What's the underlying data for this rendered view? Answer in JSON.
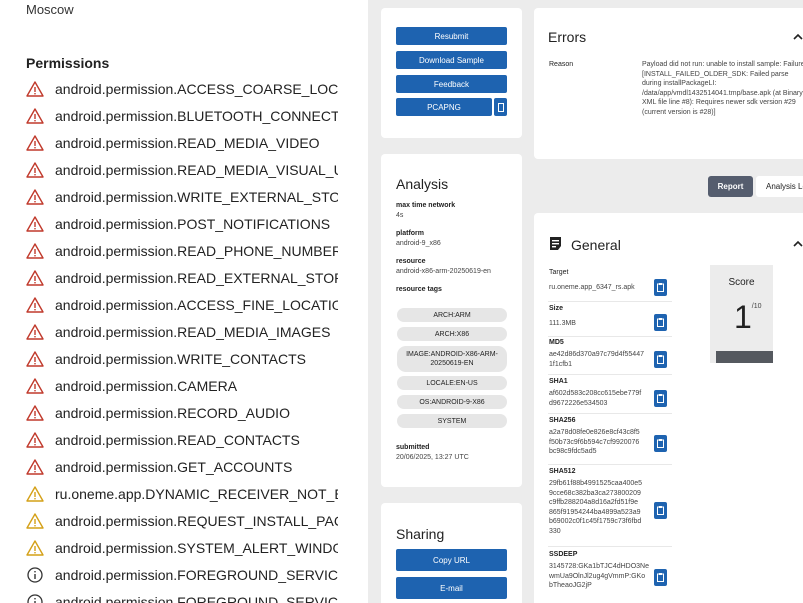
{
  "left": {
    "city": "Moscow",
    "permissions_title": "Permissions",
    "permissions": [
      {
        "name": "android.permission.ACCESS_COARSE_LOCATIC",
        "level": "danger"
      },
      {
        "name": "android.permission.BLUETOOTH_CONNECT",
        "level": "danger"
      },
      {
        "name": "android.permission.READ_MEDIA_VIDEO",
        "level": "danger"
      },
      {
        "name": "android.permission.READ_MEDIA_VISUAL_USE",
        "level": "danger"
      },
      {
        "name": "android.permission.WRITE_EXTERNAL_STORAG",
        "level": "danger"
      },
      {
        "name": "android.permission.POST_NOTIFICATIONS",
        "level": "danger"
      },
      {
        "name": "android.permission.READ_PHONE_NUMBERS",
        "level": "danger"
      },
      {
        "name": "android.permission.READ_EXTERNAL_STORAG",
        "level": "danger"
      },
      {
        "name": "android.permission.ACCESS_FINE_LOCATION",
        "level": "danger"
      },
      {
        "name": "android.permission.READ_MEDIA_IMAGES",
        "level": "danger"
      },
      {
        "name": "android.permission.WRITE_CONTACTS",
        "level": "danger"
      },
      {
        "name": "android.permission.CAMERA",
        "level": "danger"
      },
      {
        "name": "android.permission.RECORD_AUDIO",
        "level": "danger"
      },
      {
        "name": "android.permission.READ_CONTACTS",
        "level": "danger"
      },
      {
        "name": "android.permission.GET_ACCOUNTS",
        "level": "danger"
      },
      {
        "name": "ru.oneme.app.DYNAMIC_RECEIVER_NOT_EXPC",
        "level": "warning"
      },
      {
        "name": "android.permission.REQUEST_INSTALL_PACKA",
        "level": "warning"
      },
      {
        "name": "android.permission.SYSTEM_ALERT_WINDOW",
        "level": "warning"
      },
      {
        "name": "android.permission.FOREGROUND_SERVICE_M",
        "level": "info"
      },
      {
        "name": "android.permission.FOREGROUND_SERVICE_C",
        "level": "info"
      }
    ]
  },
  "actions": {
    "resubmit": "Resubmit",
    "download_sample": "Download Sample",
    "feedback": "Feedback",
    "pcapng": "PCAPNG"
  },
  "analysis": {
    "title": "Analysis",
    "max_time_network_label": "max time network",
    "max_time_network_value": "4s",
    "platform_label": "platform",
    "platform_value": "android-9_x86",
    "resource_label": "resource",
    "resource_value": "android-x86-arm-20250619-en",
    "resource_tags_label": "resource tags",
    "tags": [
      "ARCH:ARM",
      "ARCH:X86",
      "IMAGE:ANDROID-X86-ARM-20250619-EN",
      "LOCALE:EN-US",
      "OS:ANDROID-9-X86",
      "SYSTEM"
    ],
    "submitted_label": "submitted",
    "submitted_value": "20/06/2025, 13:27 UTC"
  },
  "sharing": {
    "title": "Sharing",
    "copy_url": "Copy URL",
    "email": "E-mail"
  },
  "errors": {
    "title": "Errors",
    "reason_label": "Reason",
    "reason_text": "Payload did not run: unable to install sample: Failure [INSTALL_FAILED_OLDER_SDK: Failed parse during installPackageLI: /data/app/vmdl1432514041.tmp/base.apk (at Binary XML file line #8): Requires newer sdk version #29 (current version is #28)]"
  },
  "tabs": {
    "report": "Report",
    "analysis_log": "Analysis Log"
  },
  "general": {
    "title": "General",
    "target_label": "Target",
    "target_value": "ru.oneme.app_6347_rs.apk",
    "size_label": "Size",
    "size_value": "111.3MB",
    "md5_label": "MD5",
    "md5_value": "ae42d86d370a97c79d4f55447 1f1cfb1",
    "sha1_label": "SHA1",
    "sha1_value": "af602d583c208cc615ebe779f d9672226e534503",
    "sha256_label": "SHA256",
    "sha256_value": "a2a78d08fe0e826e8cf43c8f5 f50b73c9f6b594c7cf9920076 bc98c9fdc5ad5",
    "sha512_label": "SHA512",
    "sha512_value": "29fb61f88b4991525caa400e5 9cce68c382ba3ca273800209 c9ffb288204a8d16a2fd51f9e 865f91954244ba4899a523a9 b69002c0f1c45f1759c73f6fbd 330",
    "ssdeep_label": "SSDEEP",
    "ssdeep_value": "3145728:GKa1bTJC4dHDO3Ne wmUa9OlnJl2ug4gVmmP:GKo bTheaoJG2jP",
    "score_label": "Score",
    "score_value": "1",
    "score_max": "/10"
  },
  "colors": {
    "primary_button": "#1e63b0",
    "danger": "#c0392b",
    "warning": "#d4a017",
    "info": "#333333"
  }
}
